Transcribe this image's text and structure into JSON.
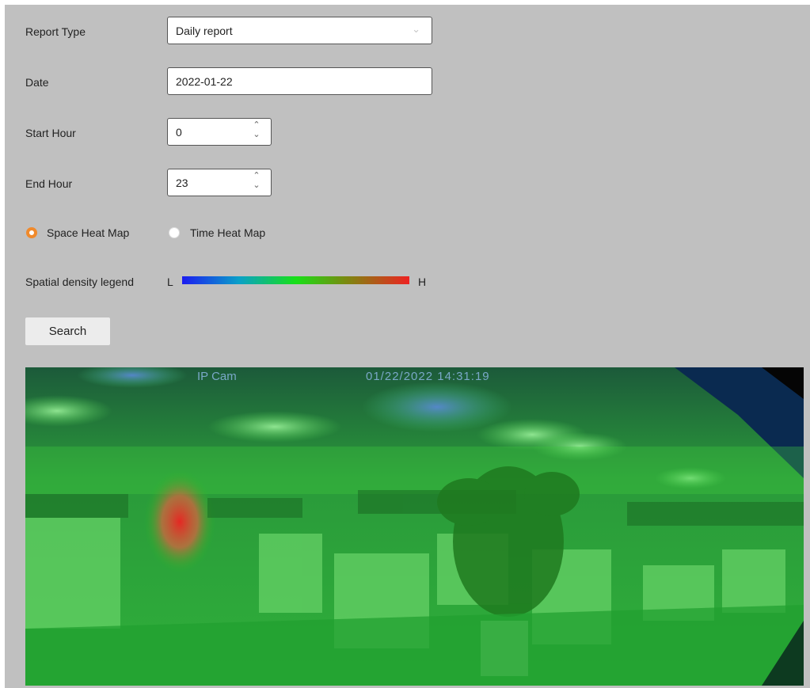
{
  "form": {
    "report_type": {
      "label": "Report Type",
      "value": "Daily report"
    },
    "date": {
      "label": "Date",
      "value": "2022-01-22"
    },
    "start_hour": {
      "label": "Start Hour",
      "value": "0"
    },
    "end_hour": {
      "label": "End Hour",
      "value": "23"
    },
    "map_mode": {
      "options": [
        "Space Heat Map",
        "Time Heat Map"
      ],
      "selected": "Space Heat Map"
    },
    "legend": {
      "label": "Spatial density legend",
      "low": "L",
      "high": "H",
      "gradient_colors": [
        "#1c1cf0",
        "#0aa0c8",
        "#18e018",
        "#7a8a10",
        "#ee2222"
      ]
    },
    "search_label": "Search"
  },
  "heatmap": {
    "camera_name": "IP Cam",
    "timestamp": "01/22/2022 14:31:19"
  },
  "colors": {
    "panel_background": "#c0c0c0",
    "radio_accent": "#f08a2c",
    "heat_low": "#1c1cf0",
    "heat_mid": "#18e018",
    "heat_high": "#ee2222"
  },
  "icons": {
    "select_arrow": "chevron-down-icon",
    "stepper": "stepper-arrows-icon"
  }
}
